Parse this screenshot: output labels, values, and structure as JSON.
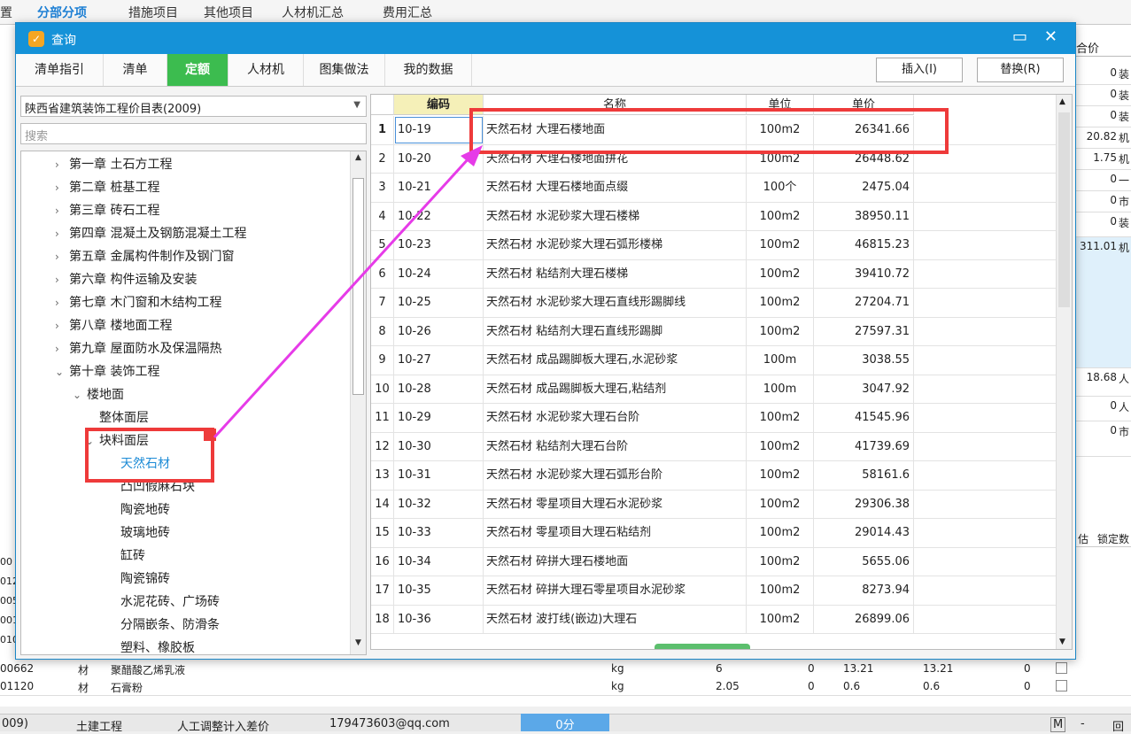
{
  "background": {
    "tabs": [
      "分部分项",
      "措施项目",
      "其他项目",
      "人材机汇总",
      "费用汇总"
    ],
    "active_tab": "分部分项",
    "right_column_header": "合价",
    "right_column": [
      {
        "value": "0",
        "char": "装"
      },
      {
        "value": "0",
        "char": "装"
      },
      {
        "value": "0",
        "char": "装"
      },
      {
        "value": "20.82",
        "char": "机"
      },
      {
        "value": "1.75",
        "char": "机"
      },
      {
        "value": "0",
        "char": "一"
      },
      {
        "value": "0",
        "char": "市"
      },
      {
        "value": "0",
        "char": "装"
      },
      {
        "value": "311.01",
        "char": "机"
      },
      {
        "value": "18.68",
        "char": "人"
      },
      {
        "value": "0",
        "char": "人"
      },
      {
        "value": "0",
        "char": "市"
      }
    ],
    "lower_header": [
      "估",
      "锁定数"
    ],
    "lower_left_codes": [
      "00",
      "012",
      "005",
      "001",
      "010"
    ],
    "bottom_rows": [
      {
        "code": "00662",
        "type": "材",
        "name": "聚醋酸乙烯乳液",
        "unit": "kg",
        "qty": "6",
        "v1": "0",
        "v2": "13.21",
        "v3": "13.21",
        "v4": "0"
      },
      {
        "code": "01120",
        "type": "材",
        "name": "石膏粉",
        "unit": "kg",
        "qty": "2.05",
        "v1": "0",
        "v2": "0.6",
        "v3": "0.6",
        "v4": "0"
      }
    ],
    "status": [
      "009)",
      "土建工程",
      "人工调整计入差价",
      "179473603@qq.com"
    ],
    "score_button": "0分",
    "status_right": [
      "M",
      "-",
      "回"
    ]
  },
  "dialog": {
    "title": "查询",
    "tabs": [
      "清单指引",
      "清单",
      "定额",
      "人材机",
      "图集做法",
      "我的数据"
    ],
    "active_tab": "定额",
    "insert_button": "插入(I)",
    "replace_button": "替换(R)",
    "library": "陕西省建筑装饰工程价目表(2009)",
    "search_placeholder": "搜索",
    "tree": [
      {
        "label": "第一章 土石方工程",
        "level": 0,
        "chev": "›"
      },
      {
        "label": "第二章 桩基工程",
        "level": 0,
        "chev": "›"
      },
      {
        "label": "第三章 砖石工程",
        "level": 0,
        "chev": "›"
      },
      {
        "label": "第四章 混凝土及钢筋混凝土工程",
        "level": 0,
        "chev": "›"
      },
      {
        "label": "第五章 金属构件制作及钢门窗",
        "level": 0,
        "chev": "›"
      },
      {
        "label": "第六章 构件运输及安装",
        "level": 0,
        "chev": "›"
      },
      {
        "label": "第七章 木门窗和木结构工程",
        "level": 0,
        "chev": "›"
      },
      {
        "label": "第八章 楼地面工程",
        "level": 0,
        "chev": "›"
      },
      {
        "label": "第九章 屋面防水及保温隔热",
        "level": 0,
        "chev": "›"
      },
      {
        "label": "第十章 装饰工程",
        "level": 0,
        "chev": "⌄"
      },
      {
        "label": "楼地面",
        "level": 1,
        "chev": "⌄"
      },
      {
        "label": "整体面层",
        "level": 2,
        "chev": ""
      },
      {
        "label": "块料面层",
        "level": 2,
        "chev": "⌄"
      },
      {
        "label": "天然石材",
        "level": 3,
        "chev": ""
      },
      {
        "label": "凸凹假麻石块",
        "level": 3,
        "chev": ""
      },
      {
        "label": "陶瓷地砖",
        "level": 3,
        "chev": ""
      },
      {
        "label": "玻璃地砖",
        "level": 3,
        "chev": ""
      },
      {
        "label": "缸砖",
        "level": 3,
        "chev": ""
      },
      {
        "label": "陶瓷锦砖",
        "level": 3,
        "chev": ""
      },
      {
        "label": "水泥花砖、广场砖",
        "level": 3,
        "chev": ""
      },
      {
        "label": "分隔嵌条、防滑条",
        "level": 3,
        "chev": ""
      },
      {
        "label": "塑料、橡胶板",
        "level": 3,
        "chev": ""
      }
    ],
    "selected_tree_item": "天然石材",
    "table_headers": [
      "编码",
      "名称",
      "单位",
      "单价"
    ],
    "rows": [
      {
        "n": "1",
        "code": "10-19",
        "name": "天然石材 大理石楼地面",
        "unit": "100m2",
        "price": "26341.66"
      },
      {
        "n": "2",
        "code": "10-20",
        "name": "天然石材 大理石楼地面拼花",
        "unit": "100m2",
        "price": "26448.62"
      },
      {
        "n": "3",
        "code": "10-21",
        "name": "天然石材 大理石楼地面点缀",
        "unit": "100个",
        "price": "2475.04"
      },
      {
        "n": "4",
        "code": "10-22",
        "name": "天然石材 水泥砂浆大理石楼梯",
        "unit": "100m2",
        "price": "38950.11"
      },
      {
        "n": "5",
        "code": "10-23",
        "name": "天然石材 水泥砂浆大理石弧形楼梯",
        "unit": "100m2",
        "price": "46815.23"
      },
      {
        "n": "6",
        "code": "10-24",
        "name": "天然石材 粘结剂大理石楼梯",
        "unit": "100m2",
        "price": "39410.72"
      },
      {
        "n": "7",
        "code": "10-25",
        "name": "天然石材 水泥砂浆大理石直线形踢脚线",
        "unit": "100m2",
        "price": "27204.71"
      },
      {
        "n": "8",
        "code": "10-26",
        "name": "天然石材 粘结剂大理石直线形踢脚",
        "unit": "100m2",
        "price": "27597.31"
      },
      {
        "n": "9",
        "code": "10-27",
        "name": "天然石材 成品踢脚板大理石,水泥砂浆",
        "unit": "100m",
        "price": "3038.55"
      },
      {
        "n": "10",
        "code": "10-28",
        "name": "天然石材 成品踢脚板大理石,粘结剂",
        "unit": "100m",
        "price": "3047.92"
      },
      {
        "n": "11",
        "code": "10-29",
        "name": "天然石材 水泥砂浆大理石台阶",
        "unit": "100m2",
        "price": "41545.96"
      },
      {
        "n": "12",
        "code": "10-30",
        "name": "天然石材 粘结剂大理石台阶",
        "unit": "100m2",
        "price": "41739.69"
      },
      {
        "n": "13",
        "code": "10-31",
        "name": "天然石材 水泥砂浆大理石弧形台阶",
        "unit": "100m2",
        "price": "58161.6"
      },
      {
        "n": "14",
        "code": "10-32",
        "name": "天然石材 零星项目大理石水泥砂浆",
        "unit": "100m2",
        "price": "29306.38"
      },
      {
        "n": "15",
        "code": "10-33",
        "name": "天然石材 零星项目大理石粘结剂",
        "unit": "100m2",
        "price": "29014.43"
      },
      {
        "n": "16",
        "code": "10-34",
        "name": "天然石材 碎拼大理石楼地面",
        "unit": "100m2",
        "price": "5655.06"
      },
      {
        "n": "17",
        "code": "10-35",
        "name": "天然石材 碎拼大理石零星项目水泥砂浆",
        "unit": "100m2",
        "price": "8273.94"
      },
      {
        "n": "18",
        "code": "10-36",
        "name": "天然石材 波打线(嵌边)大理石",
        "unit": "100m2",
        "price": "26899.06"
      }
    ]
  },
  "colors": {
    "title_blue": "#1592d8",
    "active_green": "#3cbc4f",
    "annotation_red": "#ee3a3a",
    "arrow_magenta": "#e63be8"
  }
}
